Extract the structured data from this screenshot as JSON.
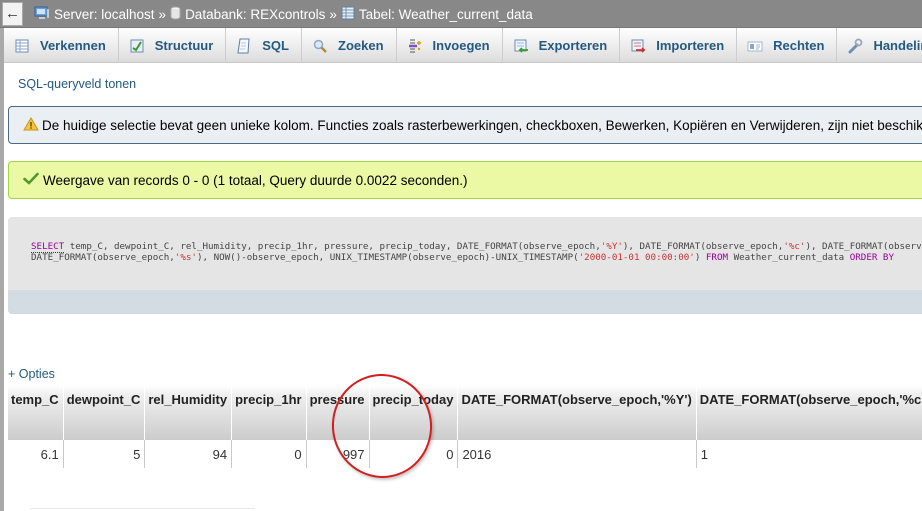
{
  "breadcrumb": {
    "back_icon": "back-arrow-icon",
    "server_label": "Server: localhost",
    "database_label": "Databank: REXcontrols",
    "table_label": "Tabel: Weather_current_data",
    "separator": "»"
  },
  "toolbar": {
    "tabs": [
      {
        "label": "Verkennen",
        "icon": "browse-table-icon"
      },
      {
        "label": "Structuur",
        "icon": "structure-icon"
      },
      {
        "label": "SQL",
        "icon": "sql-icon"
      },
      {
        "label": "Zoeken",
        "icon": "search-icon"
      },
      {
        "label": "Invoegen",
        "icon": "insert-icon"
      },
      {
        "label": "Exporteren",
        "icon": "export-icon"
      },
      {
        "label": "Importeren",
        "icon": "import-icon"
      },
      {
        "label": "Rechten",
        "icon": "privileges-icon"
      },
      {
        "label": "Handelingen",
        "icon": "operations-wrench-icon"
      }
    ]
  },
  "sql_toggle_label": "SQL-queryveld tonen",
  "notice": {
    "icon": "warning-icon",
    "text": "De huidige selectie bevat geen unieke kolom. Functies zoals rasterbewerkingen, checkboxen, Bewerken, Kopiëren en Verwijderen, zijn niet beschikbaar."
  },
  "success": {
    "icon": "checkmark-icon",
    "text": "Weergave van records 0 - 0 (1 totaal, Query duurde 0.0022 seconden.)"
  },
  "sql_query": {
    "line1_kw": "SELECT",
    "line1_a": " temp_C, dewpoint_C, rel_Humidity, precip_1hr, pressure, precip_today, DATE_FORMAT(observe_epoch,",
    "line1_s1": "'%Y'",
    "line1_b": "), DATE_FORMAT(observe_epoch,",
    "line1_s2": "'%c'",
    "line1_c": "), DATE_FORMAT(observe_epoch,",
    "line2_a": "DATE_FORMAT(observe_epoch,",
    "line2_s1": "'%s'",
    "line2_b": "), NOW()-observe_epoch, UNIX_TIMESTAMP(observe_epoch)-UNIX_TIMESTAMP(",
    "line2_s2": "'2000-01-01 00:00:00'",
    "line2_c": ") ",
    "line2_kw1": "FROM",
    "line2_d": " Weather_current_data ",
    "line2_kw2": "ORDER BY"
  },
  "options_label": "+ Opties",
  "results": {
    "columns": [
      "temp_C",
      "dewpoint_C",
      "rel_Humidity",
      "precip_1hr",
      "pressure",
      "precip_today",
      "DATE_FORMAT(observe_epoch,'%Y')",
      "DATE_FORMAT(observe_epoch,'%c')"
    ],
    "rows": [
      [
        "6.1",
        "5",
        "94",
        "0",
        "997",
        "0",
        "2016",
        "1"
      ]
    ]
  },
  "annotation": {
    "highlighted_column": "pressure",
    "color": "#d21f1f"
  }
}
